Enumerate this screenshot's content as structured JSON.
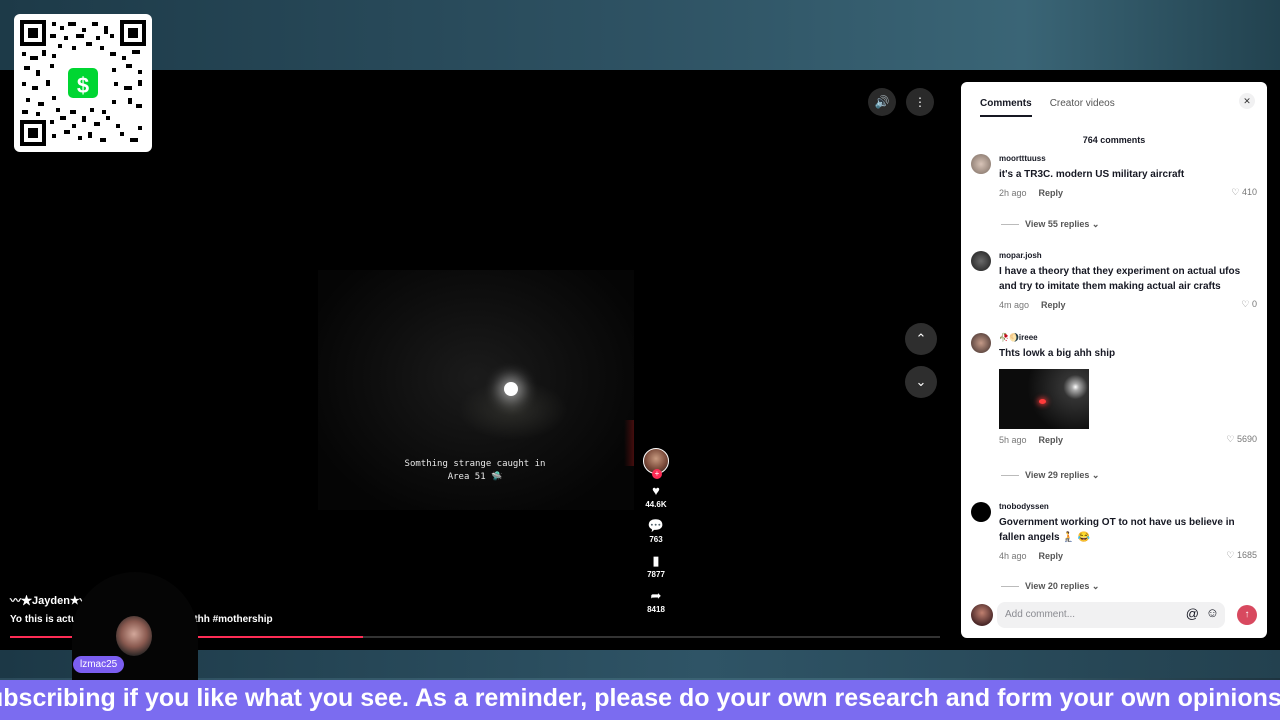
{
  "video": {
    "caption": "Somthing strange caught in Area 51 🛸",
    "creator": "〰★Jayden★〰",
    "description": "Yo this is actu... oothh #mothership",
    "description_start": "Yo this is actu",
    "description_end": "oothh #mothership",
    "progress": 0.38
  },
  "actions": {
    "likes": "44.6K",
    "comments": "763",
    "saves": "7877",
    "shares": "8418"
  },
  "icons": {
    "volume": "volume-icon",
    "more": "more-vertical-icon",
    "up": "chevron-up-icon",
    "down": "chevron-down-icon"
  },
  "panel": {
    "tab_comments": "Comments",
    "tab_creator": "Creator videos",
    "count_label": "764 comments",
    "comments": [
      {
        "user": "moortttuuss",
        "text": "it's a TR3C. modern US military aircraft",
        "time": "2h ago",
        "reply": "Reply",
        "likes": "410",
        "view_replies": "View 55 replies"
      },
      {
        "user": "mopar.josh",
        "text": "I have a theory that they experiment on actual ufos and try to imitate them making actual air crafts",
        "time": "4m ago",
        "reply": "Reply",
        "likes": "0"
      },
      {
        "user": "🥀🌖ireee",
        "text": "Thts lowk a big ahh ship",
        "time": "5h ago",
        "reply": "Reply",
        "likes": "5690",
        "view_replies": "View 29 replies"
      },
      {
        "user": "tnobodyssen",
        "text": "Government working OT to not have us believe in fallen angels 🧎 😂",
        "time": "4h ago",
        "reply": "Reply",
        "likes": "1685",
        "view_replies": "View 20 replies"
      }
    ],
    "input_placeholder": "Add comment..."
  },
  "overlay": {
    "cam_label": "lzmac25",
    "qr_symbol": "$",
    "ticker": "ubscribing if you like what you see. As a reminder, please do your own research and form your own opinions. S"
  },
  "colors": {
    "accent": "#fe2c55",
    "ticker_bg": "#7b6cf0",
    "cashapp": "#00d632"
  }
}
